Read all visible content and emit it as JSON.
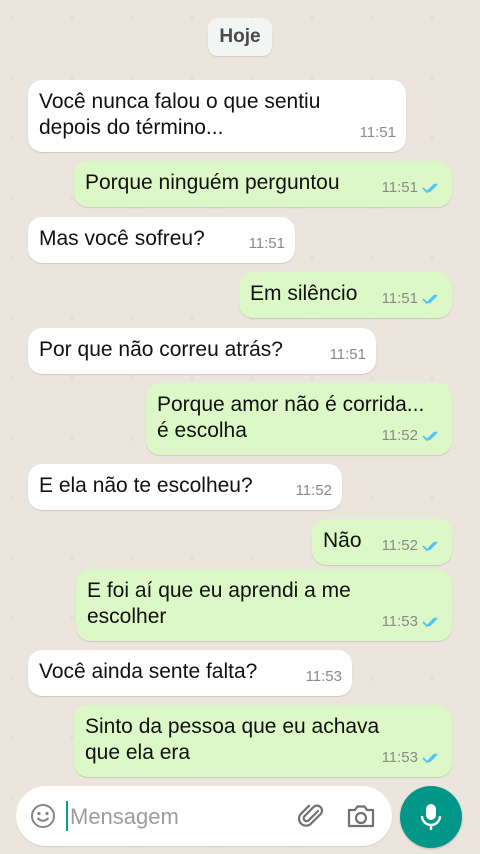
{
  "date_chip": "Hoje",
  "messages": [
    {
      "dir": "in",
      "text": "Você nunca falou o que sentiu\ndepois do término...",
      "time": "11:51"
    },
    {
      "dir": "out",
      "text": "Porque ninguém perguntou",
      "time": "11:51",
      "ticks": "read"
    },
    {
      "dir": "in",
      "text": "Mas você sofreu?",
      "time": "11:51"
    },
    {
      "dir": "out",
      "text": "Em silêncio",
      "time": "11:51",
      "ticks": "read"
    },
    {
      "dir": "in",
      "text": "Por que não correu atrás?",
      "time": "11:51"
    },
    {
      "dir": "out",
      "text": "Porque amor não é corrida...\né escolha",
      "time": "11:52",
      "ticks": "read"
    },
    {
      "dir": "in",
      "text": "E ela não te escolheu?",
      "time": "11:52"
    },
    {
      "dir": "out",
      "text": "Não",
      "time": "11:52",
      "ticks": "read"
    },
    {
      "dir": "out",
      "text": "E foi aí que eu aprendi a me\nescolher",
      "time": "11:53",
      "ticks": "read"
    },
    {
      "dir": "in",
      "text": "Você ainda sente falta?",
      "time": "11:53"
    },
    {
      "dir": "out",
      "text": "Sinto da pessoa que eu achava\nque ela era",
      "time": "11:53",
      "ticks": "read"
    }
  ],
  "composer": {
    "placeholder": "Mensagem",
    "emoji_icon": "emoji-icon",
    "attach_icon": "paperclip-icon",
    "camera_icon": "camera-icon",
    "mic_icon": "microphone-icon"
  },
  "colors": {
    "background": "#ece5dd",
    "incoming": "#ffffff",
    "outgoing": "#dcf8c6",
    "ticks": "#4fc3f7",
    "accent": "#009688"
  }
}
